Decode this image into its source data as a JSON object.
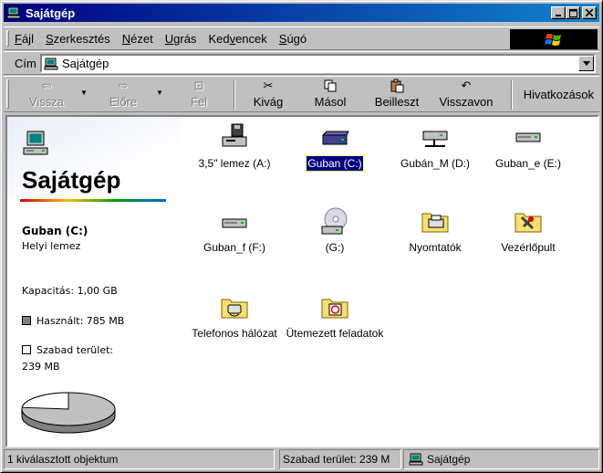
{
  "window": {
    "title": "Sajátgép"
  },
  "menu": [
    {
      "prefix": "",
      "underline": "F",
      "rest": "ájl"
    },
    {
      "prefix": "",
      "underline": "S",
      "rest": "zerkesztés"
    },
    {
      "prefix": "",
      "underline": "N",
      "rest": "ézet"
    },
    {
      "prefix": "",
      "underline": "U",
      "rest": "grás"
    },
    {
      "prefix": "Ked",
      "underline": "v",
      "rest": "encek"
    },
    {
      "prefix": "",
      "underline": "S",
      "rest": "úgó"
    }
  ],
  "address": {
    "label": "Cím",
    "value": "Sajátgép"
  },
  "toolbar": {
    "back": "Vissza",
    "forward": "Előre",
    "up": "Fel",
    "cut": "Kivág",
    "copy": "Másol",
    "paste": "Beilleszt",
    "undo": "Visszavon",
    "links": "Hivatkozások"
  },
  "sidebar": {
    "title": "Sajátgép",
    "drive_name": "Guban (C:)",
    "drive_type": "Helyi lemez",
    "capacity": "Kapacitás:  1,00 GB",
    "used": "Használt:  785 MB",
    "free_label": "Szabad terület:",
    "free_value": "239 MB"
  },
  "disk_usage": {
    "used_fraction": 0.766
  },
  "items": [
    {
      "name": "3,5\" lemez (A:)",
      "icon": "floppy-drive-icon"
    },
    {
      "name": "Guban (C:)",
      "icon": "hard-drive-icon",
      "selected": true
    },
    {
      "name": "Gubán_M (D:)",
      "icon": "network-drive-icon"
    },
    {
      "name": "Guban_e (E:)",
      "icon": "hard-drive-icon"
    },
    {
      "name": "Guban_f (F:)",
      "icon": "hard-drive-icon"
    },
    {
      "name": "(G:)",
      "icon": "cd-drive-icon"
    },
    {
      "name": "Nyomtatók",
      "icon": "printers-folder-icon"
    },
    {
      "name": "Vezérlőpult",
      "icon": "control-panel-folder-icon"
    },
    {
      "name": "Telefonos hálózat",
      "icon": "dialup-networking-folder-icon"
    },
    {
      "name": "Ütemezett feladatok",
      "icon": "scheduled-tasks-folder-icon"
    }
  ],
  "status": {
    "selection": "1 kiválasztott objektum",
    "free_space": "Szabad terület: 239 M",
    "location": "Sajátgép"
  },
  "colors": {
    "title_start": "#000080",
    "title_end": "#1084d0",
    "selection": "#000080"
  }
}
